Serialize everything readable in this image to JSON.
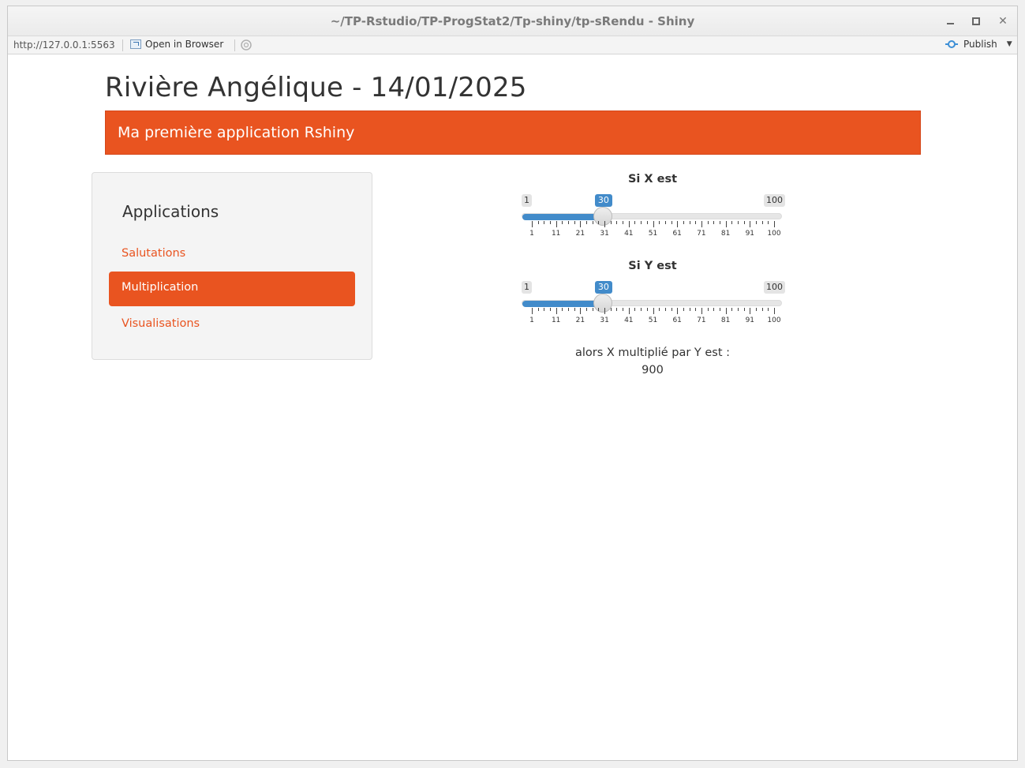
{
  "window": {
    "title": "~/TP-Rstudio/TP-ProgStat2/Tp-shiny/tp-sRendu - Shiny"
  },
  "toolbar": {
    "url": "http://127.0.0.1:5563",
    "open_in_browser": "Open in Browser",
    "publish": "Publish"
  },
  "page": {
    "title": "Rivière Angélique - 14/01/2025",
    "navbar_brand": "Ma première application Rshiny"
  },
  "sidebar": {
    "heading": "Applications",
    "items": [
      {
        "label": "Salutations",
        "active": false
      },
      {
        "label": "Multiplication",
        "active": true
      },
      {
        "label": "Visualisations",
        "active": false
      }
    ]
  },
  "sliders": [
    {
      "label": "Si X est",
      "min": 1,
      "max": 100,
      "value": 30,
      "ticks": [
        "1",
        "11",
        "21",
        "31",
        "41",
        "51",
        "61",
        "71",
        "81",
        "91",
        "100"
      ]
    },
    {
      "label": "Si Y est",
      "min": 1,
      "max": 100,
      "value": 30,
      "ticks": [
        "1",
        "11",
        "21",
        "31",
        "41",
        "51",
        "61",
        "71",
        "81",
        "91",
        "100"
      ]
    }
  ],
  "result": {
    "label": "alors X multiplié par Y est :",
    "value": "900"
  },
  "colors": {
    "accent": "#e95420",
    "slider_fill": "#428bca"
  }
}
